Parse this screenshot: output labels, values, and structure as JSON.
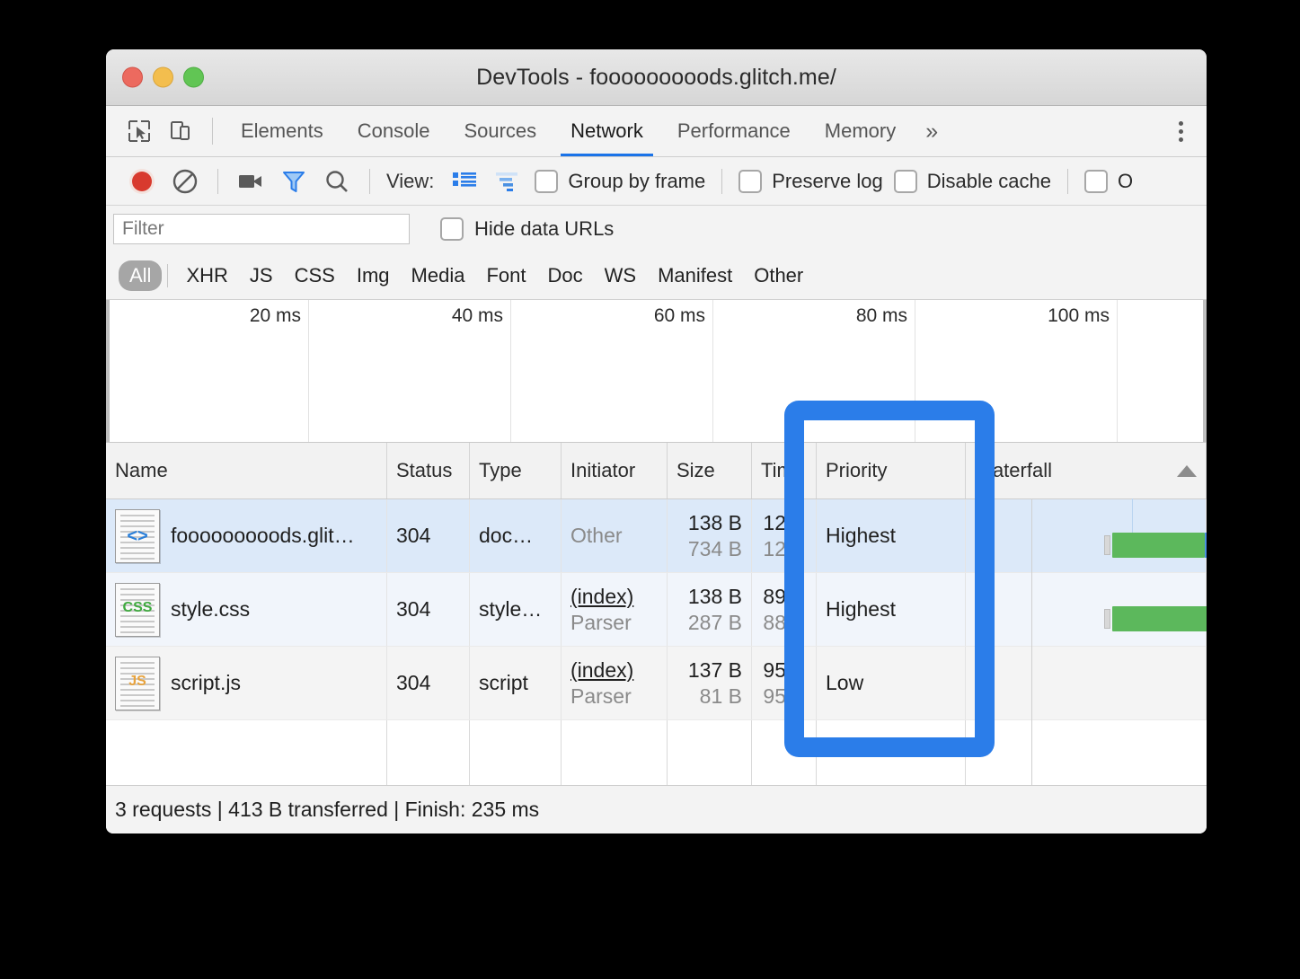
{
  "window": {
    "title": "DevTools - fooooooooods.glitch.me/",
    "traffic_lights": [
      "close",
      "minimize",
      "zoom"
    ]
  },
  "tabstrip": {
    "left_icons": [
      "inspect-element-icon",
      "device-toolbar-icon"
    ],
    "tabs": [
      {
        "label": "Elements",
        "active": false
      },
      {
        "label": "Console",
        "active": false
      },
      {
        "label": "Sources",
        "active": false
      },
      {
        "label": "Network",
        "active": true
      },
      {
        "label": "Performance",
        "active": false
      },
      {
        "label": "Memory",
        "active": false
      }
    ],
    "more_label": "»",
    "menu_icon": "kebab-menu-icon"
  },
  "net_toolbar": {
    "record_icon": "record-icon",
    "clear_icon": "clear-icon",
    "screenshot_icon": "camera-icon",
    "filter_icon": "filter-funnel-icon",
    "search_icon": "search-icon",
    "view_label": "View:",
    "list_view_icon": "list-view-icon",
    "waterfall_view_icon": "waterfall-view-icon",
    "checkboxes": [
      {
        "label": "Group by frame",
        "checked": false
      },
      {
        "label": "Preserve log",
        "checked": false
      },
      {
        "label": "Disable cache",
        "checked": false
      },
      {
        "label": "O",
        "checked": false
      }
    ]
  },
  "filter_bar": {
    "placeholder": "Filter",
    "value": "",
    "hide_data_urls_label": "Hide data URLs",
    "hide_data_urls_checked": false
  },
  "type_filters": {
    "items": [
      {
        "label": "All",
        "active": true
      },
      {
        "label": "XHR",
        "active": false
      },
      {
        "label": "JS",
        "active": false
      },
      {
        "label": "CSS",
        "active": false
      },
      {
        "label": "Img",
        "active": false
      },
      {
        "label": "Media",
        "active": false
      },
      {
        "label": "Font",
        "active": false
      },
      {
        "label": "Doc",
        "active": false
      },
      {
        "label": "WS",
        "active": false
      },
      {
        "label": "Manifest",
        "active": false
      },
      {
        "label": "Other",
        "active": false
      }
    ]
  },
  "overview": {
    "ticks": [
      "20 ms",
      "40 ms",
      "60 ms",
      "80 ms",
      "100 ms"
    ]
  },
  "table": {
    "columns": [
      {
        "key": "name",
        "label": "Name"
      },
      {
        "key": "status",
        "label": "Status"
      },
      {
        "key": "type",
        "label": "Type"
      },
      {
        "key": "initiator",
        "label": "Initiator"
      },
      {
        "key": "size",
        "label": "Size"
      },
      {
        "key": "time",
        "label": "Time"
      },
      {
        "key": "priority",
        "label": "Priority"
      },
      {
        "key": "waterfall",
        "label": "Waterfall"
      }
    ],
    "sort_indicator": "ascending-sort-arrow",
    "rows": [
      {
        "icon": "html-file-icon",
        "icon_badge": "<>",
        "name": "fooooooooods.glit…",
        "status": "304",
        "type": "doc…",
        "initiator_link": "",
        "initiator_sub": "Other",
        "size": "138 B",
        "size_sub": "734 B",
        "time": "12…",
        "time_sub": "12…",
        "priority": "Highest",
        "selected": true
      },
      {
        "icon": "css-file-icon",
        "icon_badge": "CSS",
        "name": "style.css",
        "status": "304",
        "type": "style…",
        "initiator_link": "(index)",
        "initiator_sub": "Parser",
        "size": "138 B",
        "size_sub": "287 B",
        "time": "89…",
        "time_sub": "88…",
        "priority": "Highest",
        "selected": false
      },
      {
        "icon": "js-file-icon",
        "icon_badge": "JS",
        "name": "script.js",
        "status": "304",
        "type": "script",
        "initiator_link": "(index)",
        "initiator_sub": "Parser",
        "size": "137 B",
        "size_sub": "81 B",
        "time": "95…",
        "time_sub": "95…",
        "priority": "Low",
        "selected": false
      }
    ]
  },
  "footer": {
    "summary": "3 requests | 413 B transferred | Finish: 235 ms"
  },
  "annotation": {
    "highlight_color": "#2b7de9",
    "highlight_target": "Priority column"
  },
  "colors": {
    "accent": "#1a73e8",
    "waterfall_bar": "#5cb85c",
    "selected_row": "#dce9f9",
    "record": "#d83a2e"
  }
}
